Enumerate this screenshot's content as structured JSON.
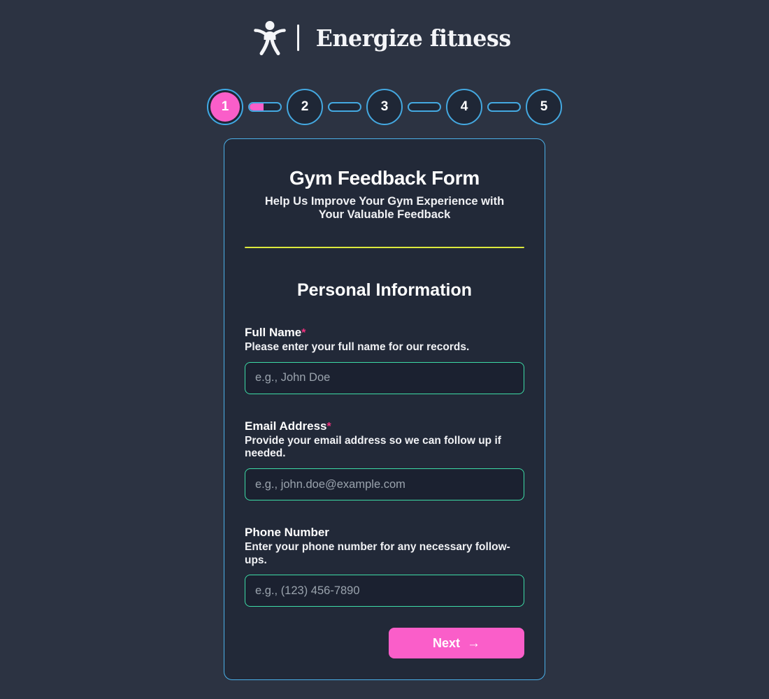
{
  "colors": {
    "page_background": "#2c3342",
    "card_background": "#222938",
    "card_border": "#4bb0e8",
    "accent_pink": "#fa5ec9",
    "accent_cyan": "#44a8e0",
    "accent_green": "#3ddba6",
    "rule_yellow": "#dce83d",
    "required_asterisk": "#f2317f"
  },
  "brand": {
    "icon": "stick-figure-icon",
    "name": "Energize fitness"
  },
  "stepper": {
    "current_step": 1,
    "steps": [
      {
        "label": "1",
        "state": "active"
      },
      {
        "label": "2",
        "state": "inactive"
      },
      {
        "label": "3",
        "state": "inactive"
      },
      {
        "label": "4",
        "state": "inactive"
      },
      {
        "label": "5",
        "state": "inactive"
      }
    ],
    "connectors": [
      {
        "fill_percent": 45
      },
      {
        "fill_percent": 0
      },
      {
        "fill_percent": 0
      },
      {
        "fill_percent": 0
      }
    ]
  },
  "form": {
    "title": "Gym Feedback Form",
    "subtitle": "Help Us Improve Your Gym Experience with Your Valuable Feedback",
    "section_title": "Personal Information",
    "fields": [
      {
        "label": "Full Name",
        "required": true,
        "required_marker": "*",
        "help": "Please enter your full name for our records.",
        "placeholder": "e.g., John Doe",
        "value": ""
      },
      {
        "label": "Email Address",
        "required": true,
        "required_marker": "*",
        "help": "Provide your email address so we can follow up if needed.",
        "placeholder": "e.g., john.doe@example.com",
        "value": ""
      },
      {
        "label": "Phone Number",
        "required": false,
        "required_marker": "",
        "help": "Enter your phone number for any necessary follow-ups.",
        "placeholder": "e.g., (123) 456-7890",
        "value": ""
      }
    ],
    "next_button": {
      "label": "Next",
      "arrow": "→"
    }
  }
}
